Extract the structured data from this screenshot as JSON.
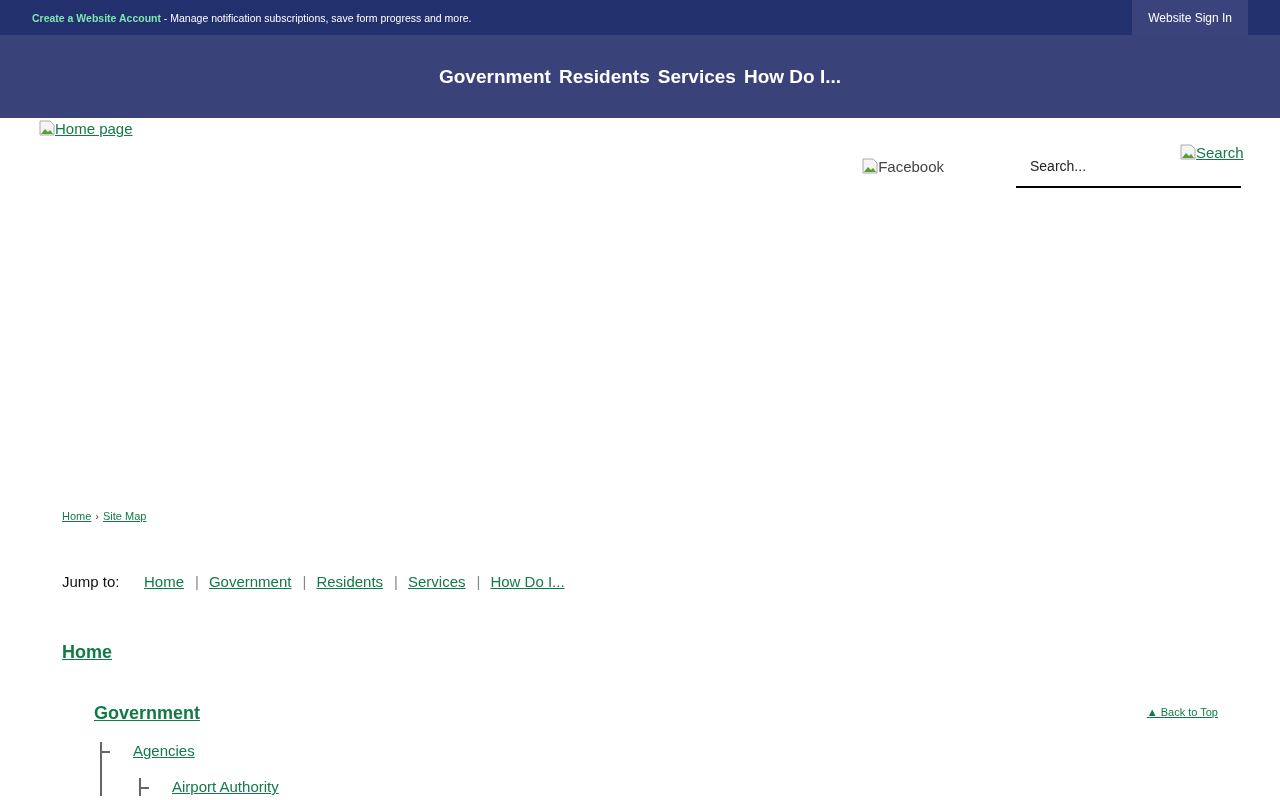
{
  "top_bar": {
    "account_link": "Create a Website Account",
    "account_text": " - Manage notification subscriptions, save form progress and more.",
    "sign_in": "Website Sign In"
  },
  "main_nav": [
    "Government",
    "Residents",
    "Services",
    "How Do I..."
  ],
  "header": {
    "logo_alt": "Home page",
    "facebook_alt": "Facebook",
    "search": {
      "placeholder": "Search..."
    },
    "search_button_alt": "Search"
  },
  "breadcrumb": {
    "links": [
      "Home",
      "Site Map"
    ],
    "separator": "›"
  },
  "jump_to": {
    "label": "Jump to:",
    "links": [
      "Home",
      "Government",
      "Residents",
      "Services",
      "How Do I..."
    ],
    "separator": "|"
  },
  "back_to_top": "▲ Back to Top",
  "tree": {
    "label": "Home",
    "children": [
      {
        "label": "Government",
        "children": [
          {
            "label": "Agencies",
            "children": [
              {
                "label": "Airport Authority"
              }
            ]
          }
        ]
      }
    ]
  }
}
